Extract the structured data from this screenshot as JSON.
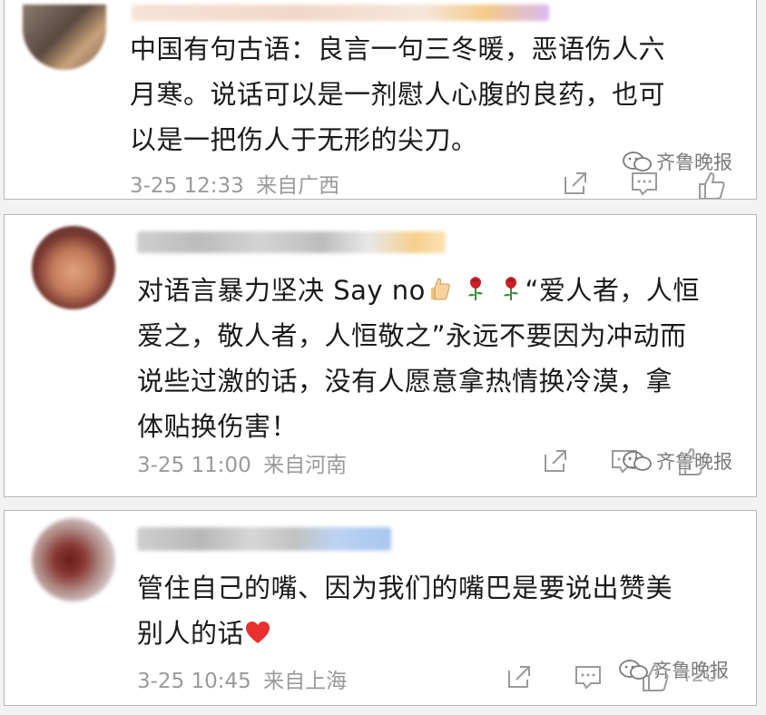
{
  "comments": [
    {
      "text": "中国有句古语：良言一句三冬暖，恶语伤人六\n月寒。说话可以是一剂慰人心腹的良药，也可\n以是一把伤人于无形的尖刀。",
      "timestamp": "3-25 12:33",
      "location": "来自广西",
      "watermark": "齐鲁晚报"
    },
    {
      "text_before": "对语言暴力坚决 Say no",
      "text_after": "“爱人者，人恒\n爱之，敬人者，人恒敬之”永远不要因为冲动而\n说些过激的话，没有人愿意拿热情换冷漠，拿\n体贴换伤害！",
      "emojis": [
        "thumbs-up",
        "rose",
        "rose"
      ],
      "timestamp": "3-25 11:00",
      "location": "来自河南",
      "watermark": "齐鲁晚报"
    },
    {
      "text": "管住自己的嘴、因为我们的嘴巴是要说出赞美\n别人的话",
      "emojis": [
        "heart"
      ],
      "timestamp": "3-25 10:45",
      "location": "来自上海",
      "like_count": "420",
      "watermark": "齐鲁晚报"
    }
  ],
  "colors": {
    "text": "#1a1a1a",
    "meta": "#9a9a9a",
    "heart": "#e8302f",
    "rose": "#c8202a"
  }
}
